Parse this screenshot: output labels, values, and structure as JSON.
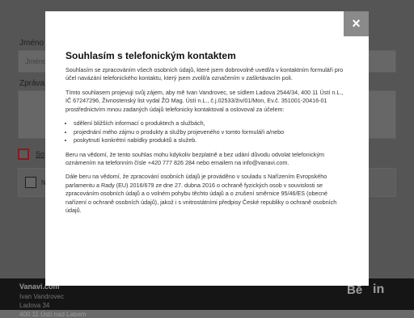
{
  "form": {
    "name_label": "Jméno *",
    "name_placeholder": "Jméno",
    "message_label": "Zpráva",
    "consent_link": "So",
    "second_checkbox_text": "N"
  },
  "footer": {
    "brand": "Vanavi.com",
    "name": "Ivan Vandrovec",
    "street": "Ladova 34",
    "city": "400 11 Ústí nad Labem",
    "icons": [
      "behance-icon",
      "linkedin-icon"
    ]
  },
  "modal": {
    "close_icon": "×",
    "title": "Souhlasím s telefonickým kontaktem",
    "p1": "Souhlasím se zpracováním všech osobních údajů, které jsem dobrovolně uvedl/a v kontaktním formuláři pro účel navázání telefonického kontaktu, který jsem zvolil/a označením v zaškrtávacím poli.",
    "p2": "Tímto souhlasem projevuji svůj zájem, aby mě Ivan Vandrovec, se sídlem Ladova 2544/34, 400 11 Ústí n.L., IČ 67247296, Živnostenský list vydal ŽO Mag. Ústí n.L., č.j.02533/živ/01/Mon, Ev.č. 351001-20416-01 prostřednictvím mnou zadaných údajů telefonicky kontaktoval a oslovoval za účelem:",
    "list": [
      "sdělení bližších informací o produktech a službách,",
      "projednání mého zájmu o produkty a služby projeveného v tomto formuláři a/nebo",
      "poskytnutí konkrétní nabídky produktů a služeb."
    ],
    "p3": "Beru na vědomí, že tento souhlas mohu kdykoliv bezplatně a bez udání důvodu odvolat telefonickým oznámením na telefonním čísle +420 777 826 284 nebo emailem na info@vanavi.com.",
    "p4": "Dále beru na vědomí, že zpracování osobních údajů je prováděno v souladu s Nařízením Evropského parlamentu a Rady (EU) 2016/679 ze dne 27. dubna 2016 o ochraně fyzických osob v souvislosti se zpracováním osobních údajů a o volném pohybu těchto údajů a o zrušení směrnice 95/46/ES (obecné nařízení o ochraně osobních údajů), jakož i s vnitrostátními předpisy České republiky o ochraně osobních údajů."
  }
}
